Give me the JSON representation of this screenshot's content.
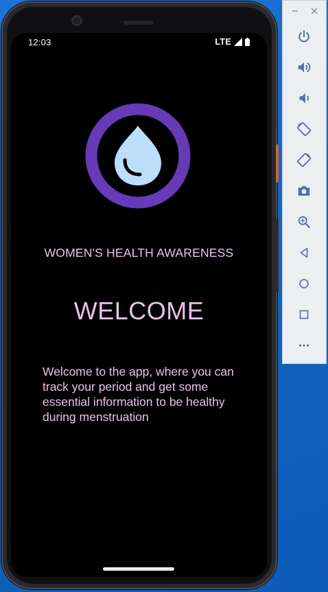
{
  "status_bar": {
    "time": "12:03",
    "network": "LTE"
  },
  "app": {
    "subtitle": "WOMEN'S HEALTH AWARENESS",
    "welcome_title": "WELCOME",
    "welcome_text": "Welcome to the app, where you can track your period and get some essential information to be healthy during menstruation"
  },
  "colors": {
    "ring": "#673ab7",
    "drop": "#bbdefb",
    "text": "#e8c2ea",
    "screen_bg": "#000000"
  },
  "emulator_toolbar": {
    "window_controls": [
      "minimize-icon",
      "close-icon"
    ],
    "buttons": [
      "power-icon",
      "volume-up-icon",
      "volume-down-icon",
      "rotate-left-icon",
      "rotate-right-icon",
      "camera-icon",
      "zoom-icon",
      "back-icon",
      "home-icon",
      "overview-icon",
      "more-icon"
    ]
  }
}
